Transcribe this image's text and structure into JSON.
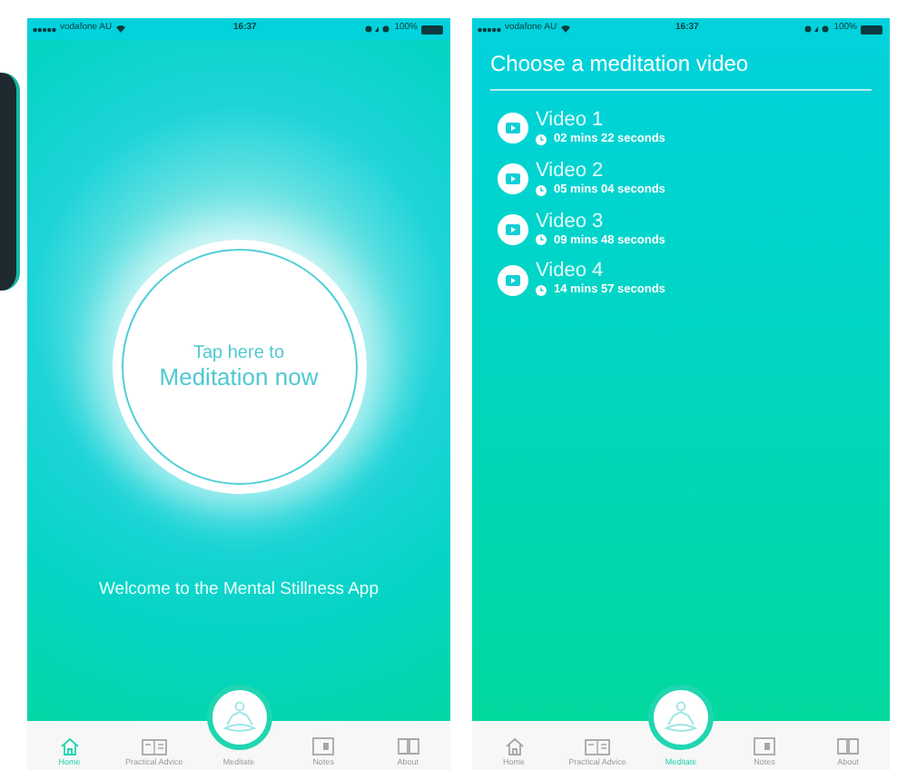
{
  "screens": [
    {
      "kind": "home",
      "status_bar": {
        "carrier": "vodafone AU",
        "time": "16:37",
        "battery": "100%"
      },
      "prompt_small": "Tap here to",
      "prompt_large": "Meditation now",
      "welcome": "Welcome to the Mental Stillness App",
      "tabs": [
        {
          "label": "Home",
          "selected": true
        },
        {
          "label": "Practical Advice",
          "selected": false
        },
        {
          "label": "Meditate",
          "selected": false
        },
        {
          "label": "Notes",
          "selected": false
        },
        {
          "label": "About",
          "selected": false
        }
      ]
    },
    {
      "kind": "video_list",
      "status_bar": {
        "carrier": "vodafone AU",
        "time": "16:37",
        "battery": "100%"
      },
      "title": "Choose a meditation video",
      "videos": [
        {
          "name": "Video 1",
          "duration": "02 mins 22 seconds"
        },
        {
          "name": "Video 2",
          "duration": "05 mins 04 seconds"
        },
        {
          "name": "Video 3",
          "duration": "09 mins 48 seconds"
        },
        {
          "name": "Video 4",
          "duration": "14 mins 57 seconds"
        }
      ],
      "tabs": [
        {
          "label": "Home",
          "selected": false
        },
        {
          "label": "Practical Advice",
          "selected": false
        },
        {
          "label": "Meditate",
          "selected": true
        },
        {
          "label": "Notes",
          "selected": false
        },
        {
          "label": "About",
          "selected": false
        }
      ]
    }
  ]
}
